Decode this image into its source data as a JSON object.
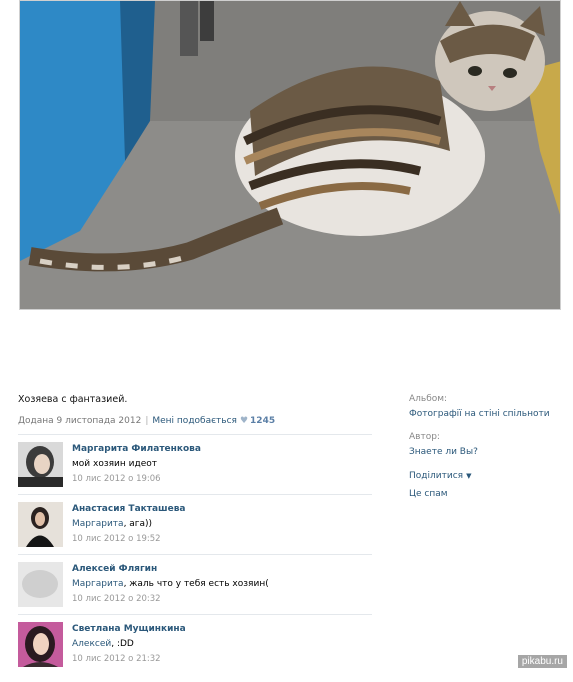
{
  "post": {
    "caption": "Хозяева с фантазией.",
    "date": "Додана 9 листопада 2012",
    "like_label": "Мені подобається",
    "like_count": "1245"
  },
  "comments": [
    {
      "name": "Маргарита Филатенкова",
      "reply_to": "",
      "text": "мой хозяин идеот",
      "date": "10 лис 2012 о 19:06"
    },
    {
      "name": "Анастасия Такташева",
      "reply_to": "Маргарита",
      "text": ", ага))",
      "date": "10 лис 2012 о 19:52"
    },
    {
      "name": "Алексей Флягин",
      "reply_to": "Маргарита",
      "text": ", жаль что у тебя есть хозяин(",
      "date": "10 лис 2012 о 20:32"
    },
    {
      "name": "Светлана Мущинкина",
      "reply_to": "Алексей",
      "text": ", :DD",
      "date": "10 лис 2012 о 21:32"
    }
  ],
  "sidebar": {
    "album_label": "Альбом:",
    "album_value": "Фотографії на стіні спільноти",
    "author_label": "Автор:",
    "author_value": "Знаете ли Вы?",
    "share_label": "Поділитися",
    "spam_label": "Це спам"
  },
  "watermark": "pikabu.ru",
  "colors": {
    "link": "#2B587A",
    "muted": "#777777"
  }
}
